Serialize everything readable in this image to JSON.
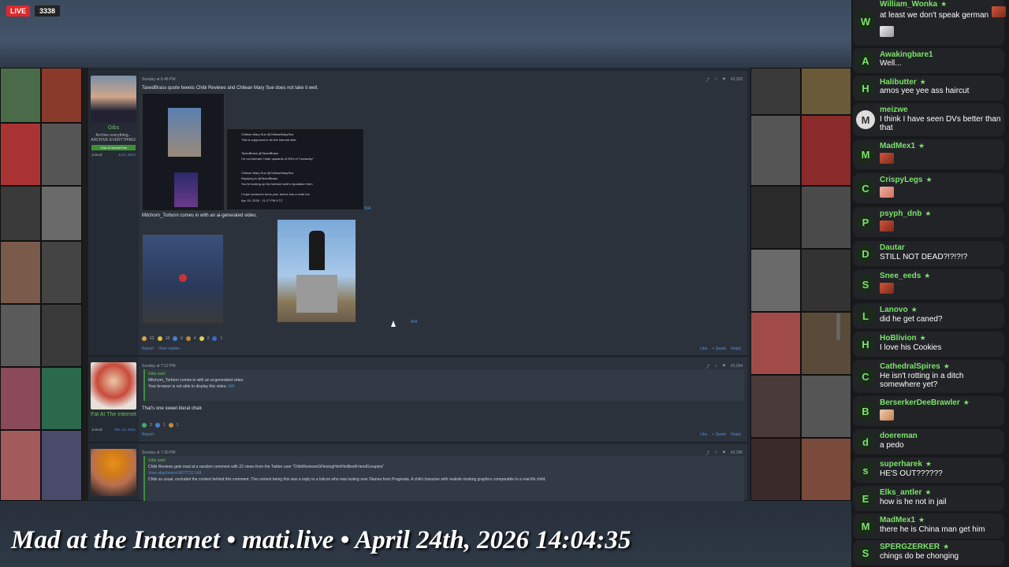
{
  "stream": {
    "live_label": "LIVE",
    "viewer_count": "3338",
    "overlay_title": "Mad at the Internet • mati.live • April 24th, 2026 14:04:35"
  },
  "forum": {
    "posts": [
      {
        "username": "Gibs",
        "user_title": "Archive everything...",
        "user_title2": "ARCHIVE EVERYTHING!",
        "badge": "True & Honest Fan",
        "joined_label": "Joined:",
        "joined_value": "Jul 8, 2022",
        "timestamp": "Sunday at 6:48 PM",
        "post_number": "#2,193",
        "text_1": "TaxedBrass quote tweets Chibi Reviews and Chilean Mary Sue does not take it well.",
        "tweet_1": "Chilean Mary Sue @ChileanMarySue",
        "tweet_1_body": "This is supposed to be the tolerant side",
        "tweet_2": "TaxedBrass @TaxedBrass",
        "tweet_2_body": "I'm not tolerant I hate upwards of 90% of \"humanity\"",
        "tweet_3": "Chilean Mary Sue @ChileanMarySue",
        "tweet_3_reply": "Replying to @TaxedBrass",
        "tweet_3_body": "You're fucking up the tolerant side's reputation then",
        "tweet_3_body2": "I hope someone turns your bones into a chair too",
        "tweet_3_date": "Apr 19, 2026 · 11:17 PM UTC",
        "na_1": "N/A",
        "text_2": "Mitchorn_Torborn comes in with an ai-generated video.",
        "na_2": "N/A",
        "reactions": [
          "62",
          "18",
          "6",
          "4",
          "2",
          "1"
        ],
        "report": "Report",
        "view_replies": "View replies",
        "like": "Like",
        "quote": "+ Quote",
        "reply": "Reply"
      },
      {
        "username": "Fat At The Internet",
        "joined_label": "Joined:",
        "joined_value": "Dec 12, 2021",
        "timestamp": "Sunday at 7:12 PM",
        "post_number": "#2,194",
        "quote_head": "Gibs said:",
        "quote_line": "Mitchorn_Torborn comes in with an ai-generated video.",
        "quote_video": "Your browser is not able to display this video.",
        "quote_na": "N/A",
        "text_1": "That's one sweet literal chair.",
        "reactions": [
          "3",
          "1",
          "1"
        ],
        "report": "Report",
        "like": "Like",
        "quote": "+ Quote",
        "reply": "Reply"
      },
      {
        "timestamp": "Sunday at 7:30 PM",
        "post_number": "#2,195",
        "quote_head": "Gibs said:",
        "quote_line_1": "Chibi Reviews gets mad at a random comment with 22 views from the Twitter user \"ChibiReviewsGFlexingHimHimBestFriendGroupies\"",
        "quote_line_2": "View attachment 8877732 N/A",
        "quote_line_3": "Chibi as usual, excluded the context behind this comment. The context being this was a reply to a lolicon who was lusting over Dianna from Pragmata. A child character with realistic-looking graphics comparable to a real-life child."
      }
    ]
  },
  "chat": {
    "messages": [
      {
        "initial": "W",
        "name": "William_Wonka",
        "star": true,
        "text": "at least we don't speak german",
        "emote": "cat"
      },
      {
        "initial": "A",
        "name": "Awakingbare1",
        "star": false,
        "text": "Well..."
      },
      {
        "initial": "H",
        "name": "Halibutter",
        "star": true,
        "text": "amos yee yee ass haircut"
      },
      {
        "initial": "M",
        "name": "meizwe",
        "star": false,
        "text": "I think I have seen DVs better than that"
      },
      {
        "initial": "M",
        "name": "MadMex1",
        "star": true,
        "text": "",
        "emote": "face"
      },
      {
        "initial": "C",
        "name": "CrispyLegs",
        "star": true,
        "text": "",
        "emote": "face"
      },
      {
        "initial": "P",
        "name": "psyph_dnb",
        "star": true,
        "text": "",
        "emote": "face"
      },
      {
        "initial": "D",
        "name": "Dautar",
        "star": false,
        "text": "STILL NOT DEAD?!?!?!?"
      },
      {
        "initial": "S",
        "name": "Snee_eeds",
        "star": true,
        "text": "",
        "emote": "face"
      },
      {
        "initial": "L",
        "name": "Lanovo",
        "star": true,
        "text": "did he get caned?"
      },
      {
        "initial": "H",
        "name": "HoBlivion",
        "star": true,
        "text": "I love his Cookies"
      },
      {
        "initial": "C",
        "name": "CathedralSpires",
        "star": true,
        "text": "He isn't rotting in a ditch somewhere yet?"
      },
      {
        "initial": "B",
        "name": "BerserkerDeeBrawler",
        "star": true,
        "text": "",
        "emote": "face"
      },
      {
        "initial": "d",
        "name": "doereman",
        "star": false,
        "text": "a pedo"
      },
      {
        "initial": "s",
        "name": "superharek",
        "star": true,
        "text": "HE'S OUT??????"
      },
      {
        "initial": "E",
        "name": "Elks_antler",
        "star": true,
        "text": "how is he not in jail"
      },
      {
        "initial": "M",
        "name": "MadMex1",
        "star": true,
        "text": "there he is China man get him"
      },
      {
        "initial": "S",
        "name": "SPERGZERKER",
        "star": true,
        "text": "chings do be chonging"
      }
    ]
  }
}
